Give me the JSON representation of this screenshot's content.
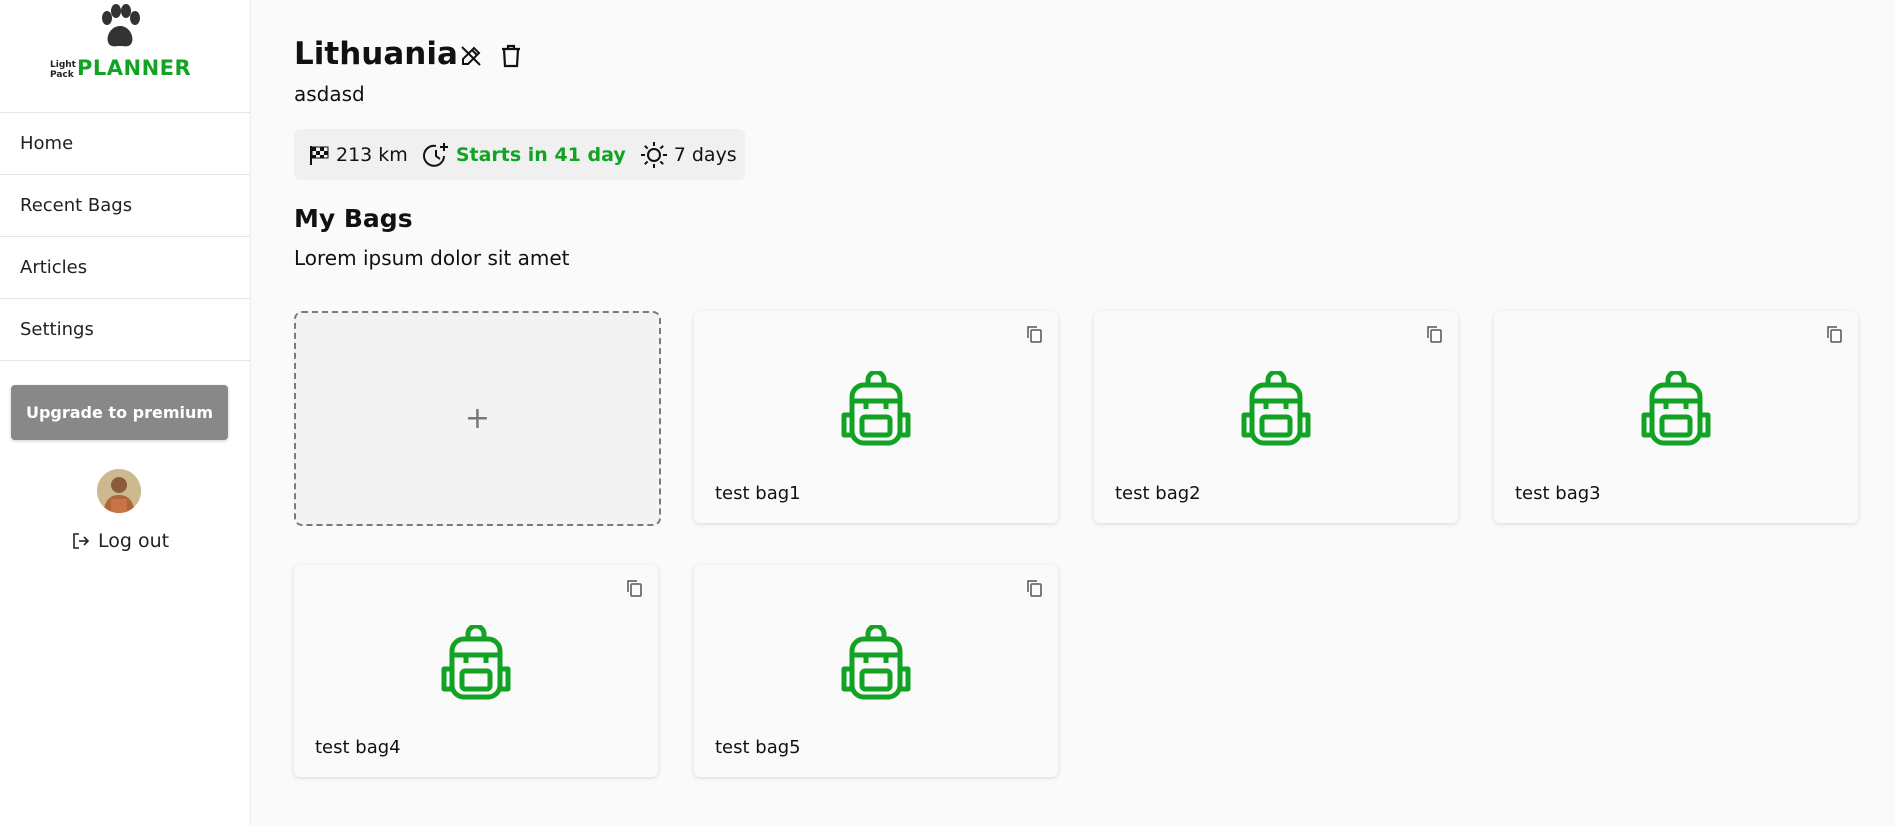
{
  "brand": {
    "logo_small": "Light Pack",
    "logo_big": "PLANNER",
    "accent": "#13a324"
  },
  "sidebar": {
    "nav": [
      {
        "label": "Home"
      },
      {
        "label": "Recent Bags"
      },
      {
        "label": "Articles"
      },
      {
        "label": "Settings"
      }
    ],
    "premium_label": "Upgrade to premium",
    "logout_label": "Log out"
  },
  "trip": {
    "title": "Lithuania",
    "description": "asdasd",
    "distance": "213 km",
    "starts": "Starts in 41 day",
    "duration": "7 days"
  },
  "bags_section": {
    "title": "My Bags",
    "description": "Lorem ipsum dolor sit amet",
    "add_symbol": "+",
    "bags": [
      {
        "name": "test bag1"
      },
      {
        "name": "test bag2"
      },
      {
        "name": "test bag3"
      },
      {
        "name": "test bag4"
      },
      {
        "name": "test bag5"
      }
    ]
  }
}
